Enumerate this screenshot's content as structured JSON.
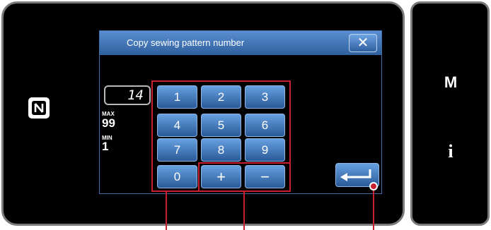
{
  "dialog": {
    "title": "Copy sewing pattern number",
    "close_icon": "close-icon",
    "value": "14",
    "max_label": "MAX",
    "max_value": "99",
    "min_label": "MIN",
    "min_value": "1"
  },
  "keypad": {
    "digits": [
      "1",
      "2",
      "3",
      "4",
      "5",
      "6",
      "7",
      "8",
      "9",
      "0"
    ],
    "plus": "+",
    "minus": "−"
  },
  "side_panel": {
    "mode_label": "M",
    "info_label": "i"
  },
  "icons": {
    "nfc": "nfc-icon",
    "enter": "enter-icon"
  },
  "colors": {
    "key_blue": "#3f78bd",
    "title_blue": "#4576b8",
    "callout_red": "#c8202f",
    "frame_gray": "#7a7a7a"
  }
}
